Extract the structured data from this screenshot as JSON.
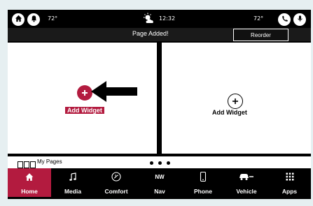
{
  "status_bar": {
    "left_temp": "72°",
    "time": "12:32",
    "right_temp": "72°",
    "icons": [
      "home-icon",
      "bell-icon",
      "partly-cloudy-icon",
      "phone-call-icon",
      "microphone-icon"
    ]
  },
  "banner": {
    "message": "Page Added!",
    "reorder_label": "Reorder"
  },
  "panels": {
    "left": {
      "label": "Add Widget",
      "icon": "plus-icon",
      "highlight_color": "#b31b3f"
    },
    "right": {
      "label": "Add Widget",
      "icon": "plus-icon"
    }
  },
  "pages": {
    "label": "My Pages",
    "indicator_count": 3
  },
  "nav": {
    "items": [
      {
        "label": "Home",
        "icon": "home-icon",
        "active": true
      },
      {
        "label": "Media",
        "icon": "music-note-icon"
      },
      {
        "label": "Comfort",
        "icon": "seat-heat-icon"
      },
      {
        "label": "Nav",
        "icon": "compass-icon",
        "icon_text": "NW"
      },
      {
        "label": "Phone",
        "icon": "phone-icon"
      },
      {
        "label": "Vehicle",
        "icon": "car-icon"
      },
      {
        "label": "Apps",
        "icon": "apps-grid-icon"
      }
    ],
    "accent_color": "#b31b3f"
  }
}
